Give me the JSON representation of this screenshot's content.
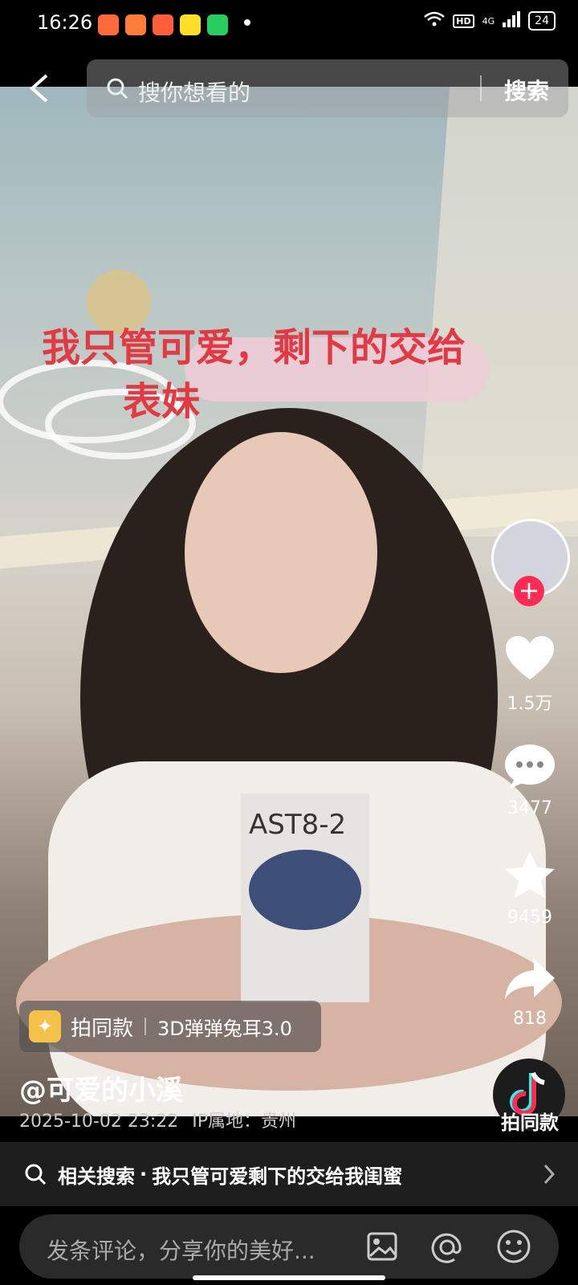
{
  "status": {
    "time": "16:26",
    "battery": "24",
    "network": "4G"
  },
  "search": {
    "placeholder": "搜你想看的",
    "button": "搜索"
  },
  "video": {
    "caption_line1": "我只管可爱，剩下的交给",
    "caption_line2": "表妹"
  },
  "actions": {
    "likes": "1.5万",
    "comments": "3477",
    "favorites": "9459",
    "shares": "818",
    "shoot_same_label": "拍同款"
  },
  "effect": {
    "label": "拍同款",
    "name": "3D弹弹兔耳3.0"
  },
  "author": {
    "name": "@可爱的小溪",
    "date": "2025-10-02 23:22",
    "location": "IP属地：贵州"
  },
  "related": {
    "label": "相关搜索",
    "query": "我只管可爱剩下的交给我闺蜜"
  },
  "comment": {
    "placeholder": "发条评论，分享你的美好..."
  }
}
